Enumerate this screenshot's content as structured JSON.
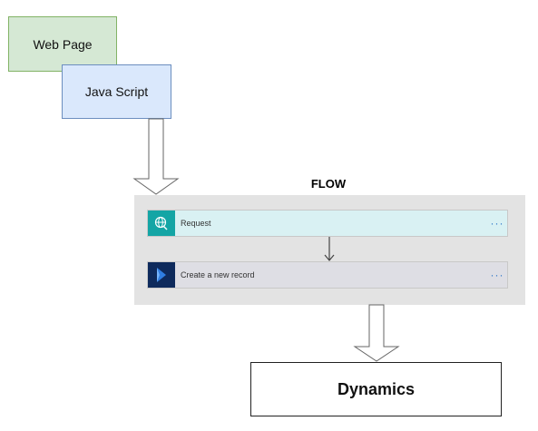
{
  "nodes": {
    "webpage": "Web Page",
    "javascript": "Java Script",
    "dynamics": "Dynamics"
  },
  "flow": {
    "title": "FLOW",
    "steps": [
      {
        "label": "Request",
        "icon": "globe-icon",
        "menu": "···"
      },
      {
        "label": "Create a new record",
        "icon": "dynamics-logo-icon",
        "menu": "···"
      }
    ]
  },
  "colors": {
    "webpage_fill": "#d5e8d4",
    "javascript_fill": "#dae8fc",
    "request_icon": "#14a5a5",
    "dynamics_icon": "#0e2a5c",
    "panel": "#e3e3e3"
  }
}
